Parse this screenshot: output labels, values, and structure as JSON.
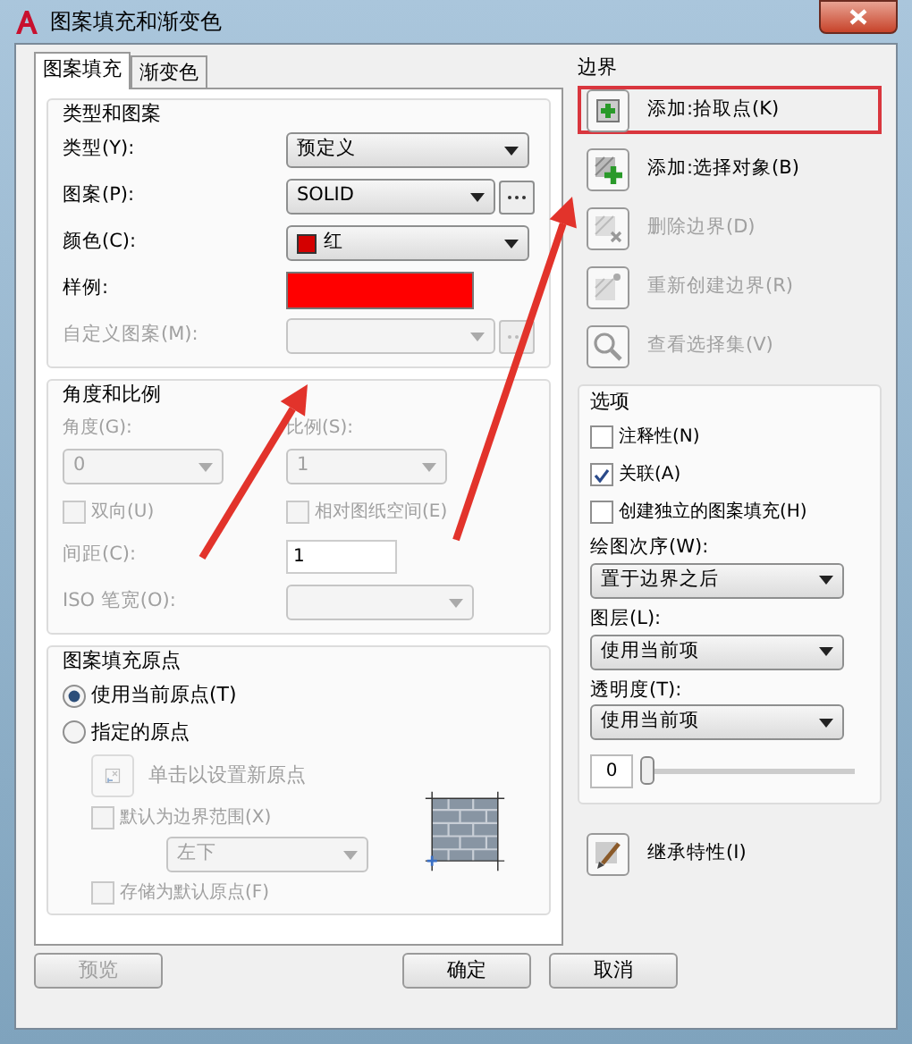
{
  "window": {
    "title": "图案填充和渐变色"
  },
  "tabs": [
    {
      "label": "图案填充",
      "selected": true
    },
    {
      "label": "渐变色",
      "selected": false
    }
  ],
  "type_and_pattern": {
    "title": "类型和图案",
    "fields": [
      {
        "label": "类型(Y):",
        "kind": "select",
        "value": "预定义",
        "disabled": false
      },
      {
        "label": "图案(P):",
        "kind": "select-browse",
        "value": "SOLID",
        "disabled": false
      },
      {
        "label": "颜色(C):",
        "kind": "color-select",
        "value": "红",
        "color": "#d40000",
        "disabled": false
      },
      {
        "label": "样例:",
        "kind": "swatch",
        "color": "#ff0000",
        "disabled": false
      },
      {
        "label": "自定义图案(M):",
        "kind": "select-browse",
        "disabled": true
      }
    ]
  },
  "angle_and_scale": {
    "title": "角度和比例",
    "angle": {
      "label": "角度(G):",
      "value": "0",
      "disabled": true
    },
    "scale": {
      "label": "比例(S):",
      "value": "1",
      "disabled": true
    },
    "double": {
      "label": "双向(U)",
      "checked": false,
      "disabled": true
    },
    "relative": {
      "label": "相对图纸空间(E)",
      "checked": false,
      "disabled": true
    },
    "spacing": {
      "label": "间距(C):",
      "value": "1",
      "disabled": true
    },
    "iso_pen_width": {
      "label": "ISO 笔宽(O):",
      "disabled": true
    }
  },
  "origin": {
    "title": "图案填充原点",
    "options": [
      {
        "label": "使用当前原点(T)",
        "selected": true
      },
      {
        "label": "指定的原点",
        "selected": false
      }
    ],
    "click_set": {
      "label": "单击以设置新原点",
      "disabled": true
    },
    "default_extent": {
      "label": "默认为边界范围(X)",
      "checked": false,
      "disabled": true
    },
    "position": {
      "value": "左下",
      "disabled": true
    },
    "store_default": {
      "label": "存储为默认原点(F)",
      "checked": false,
      "disabled": true
    }
  },
  "boundaries": {
    "title": "边界",
    "buttons": [
      {
        "label": "添加:拾取点(K)",
        "kind": "pick",
        "disabled": false,
        "highlighted": true
      },
      {
        "label": "添加:选择对象(B)",
        "kind": "select",
        "disabled": false,
        "highlighted": false
      },
      {
        "label": "删除边界(D)",
        "kind": "remove",
        "disabled": true,
        "highlighted": false
      },
      {
        "label": "重新创建边界(R)",
        "kind": "recreate",
        "disabled": true,
        "highlighted": false
      },
      {
        "label": "查看选择集(V)",
        "kind": "view",
        "disabled": true,
        "highlighted": false
      }
    ]
  },
  "options": {
    "title": "选项",
    "checkboxes": [
      {
        "label": "注释性(N)",
        "checked": false
      },
      {
        "label": "关联(A)",
        "checked": true
      },
      {
        "label": "创建独立的图案填充(H)",
        "checked": false
      }
    ],
    "selects": [
      {
        "label": "绘图次序(W):",
        "value": "置于边界之后"
      },
      {
        "label": "图层(L):",
        "value": "使用当前项"
      },
      {
        "label": "透明度(T):",
        "value": "使用当前项"
      }
    ],
    "transparency": {
      "value": "0",
      "level": 0
    }
  },
  "inherit": {
    "label": "继承特性(I)"
  },
  "buttons": [
    {
      "label": "预览",
      "disabled": true
    },
    {
      "label": "确定",
      "disabled": false
    },
    {
      "label": "取消",
      "disabled": false
    }
  ],
  "annotations": [
    {
      "kind": "arrow"
    },
    {
      "kind": "arrow"
    }
  ]
}
